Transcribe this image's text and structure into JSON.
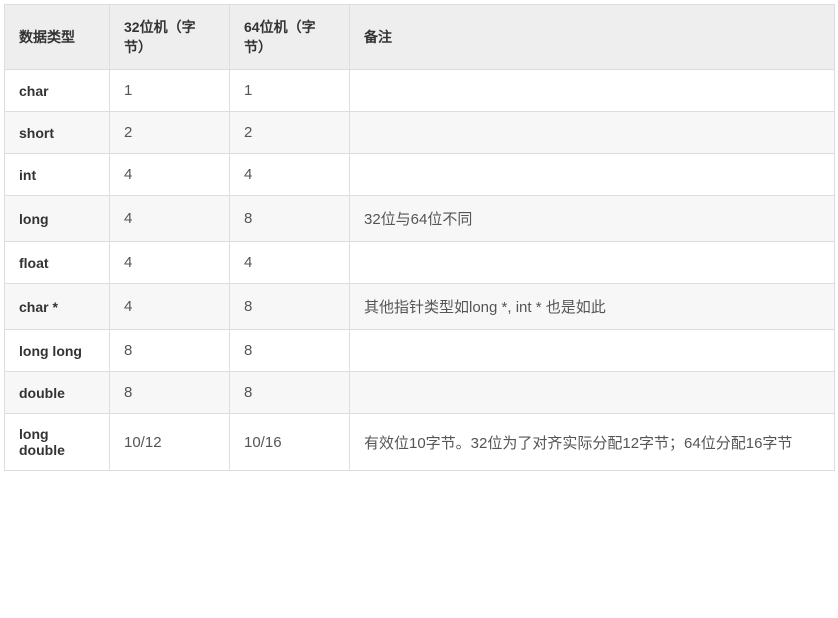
{
  "chart_data": {
    "type": "table",
    "headers": [
      "数据类型",
      "32位机（字节）",
      "64位机（字节）",
      "备注"
    ],
    "rows": [
      {
        "type": "char",
        "bit32": "1",
        "bit64": "1",
        "remark": ""
      },
      {
        "type": "short",
        "bit32": "2",
        "bit64": "2",
        "remark": ""
      },
      {
        "type": "int",
        "bit32": "4",
        "bit64": "4",
        "remark": ""
      },
      {
        "type": "long",
        "bit32": "4",
        "bit64": "8",
        "remark": "32位与64位不同"
      },
      {
        "type": "float",
        "bit32": "4",
        "bit64": "4",
        "remark": ""
      },
      {
        "type": "char *",
        "bit32": "4",
        "bit64": "8",
        "remark": "其他指针类型如long *, int * 也是如此"
      },
      {
        "type": "long long",
        "bit32": "8",
        "bit64": "8",
        "remark": ""
      },
      {
        "type": "double",
        "bit32": "8",
        "bit64": "8",
        "remark": ""
      },
      {
        "type": "long double",
        "bit32": "10/12",
        "bit64": "10/16",
        "remark": "有效位10字节。32位为了对齐实际分配12字节；64位分配16字节"
      }
    ]
  }
}
